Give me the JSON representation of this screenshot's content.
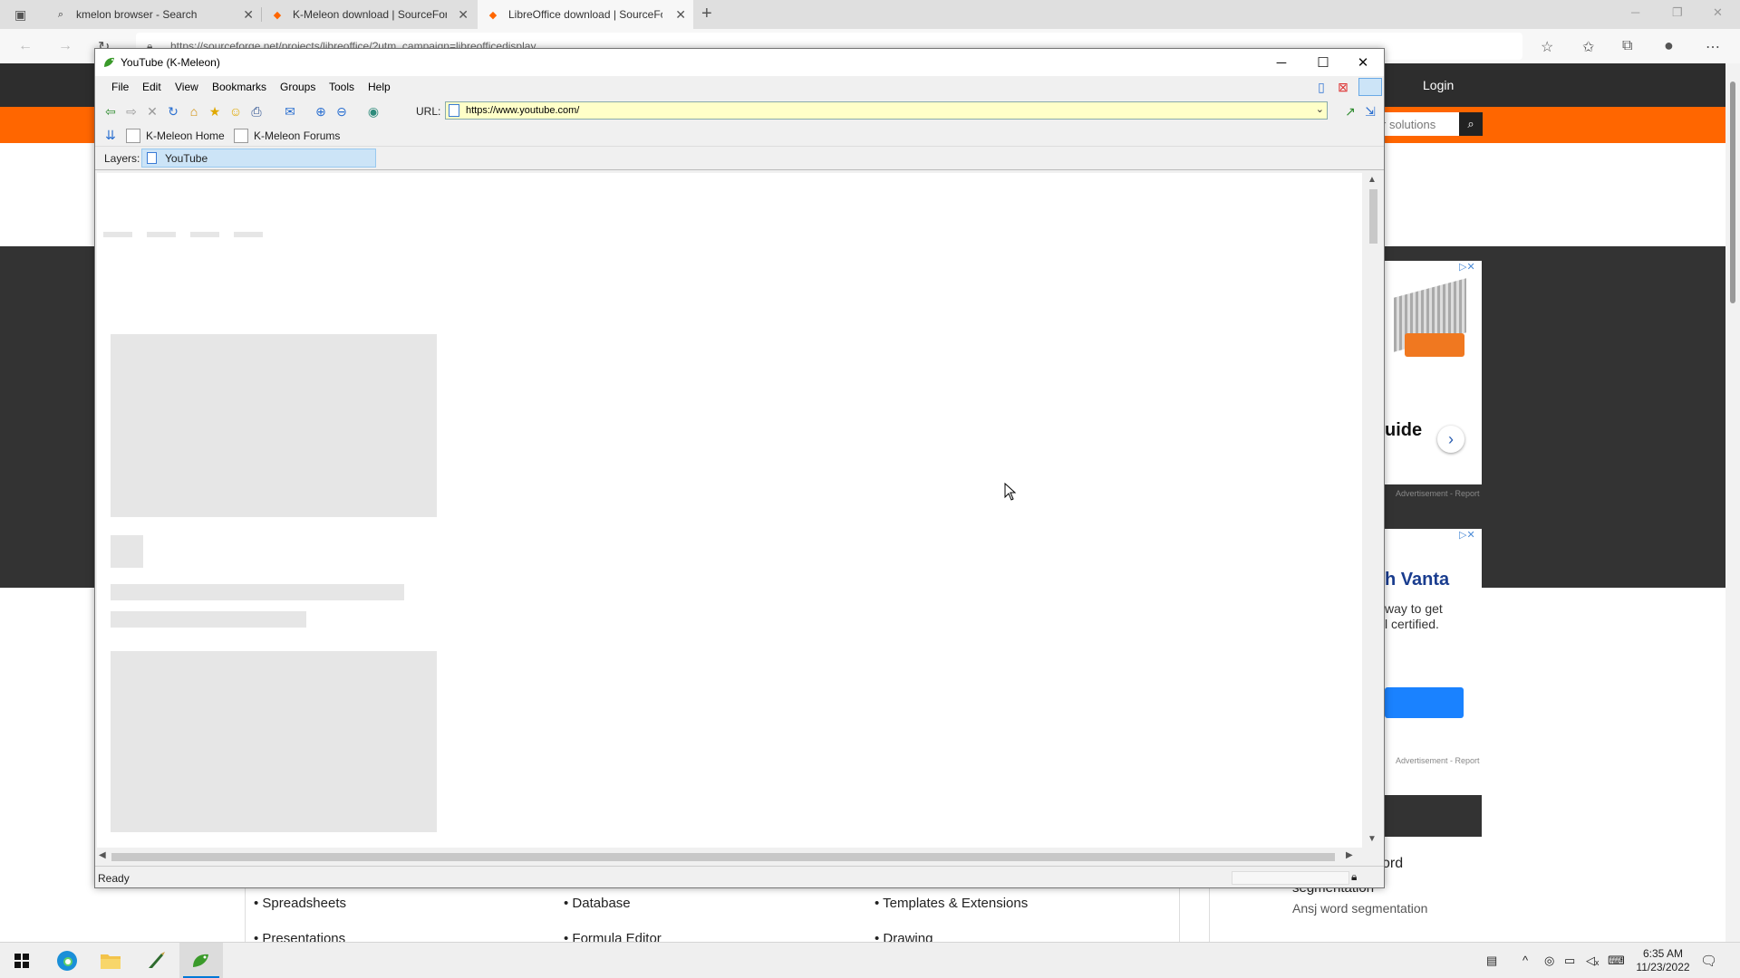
{
  "edge": {
    "tabs": [
      {
        "title": "kmelon browser - Search",
        "icon": "search-icon"
      },
      {
        "title": "K-Meleon download | SourceFor",
        "icon": "sourceforge-icon"
      },
      {
        "title": "LibreOffice download | SourceFo",
        "icon": "sourceforge-icon"
      }
    ],
    "address": "https://sourceforge.net/projects/libreoffice/?utm_campaign=libreofficedisplay"
  },
  "sourceforge": {
    "login_label": "Login",
    "search_placeholder": "r solutions",
    "ad1_text": "uide",
    "ad_label": "Advertisement - Report",
    "ad2_title": "h Vanta",
    "ad2_line1": "way to get",
    "ad2_line2": "l certified.",
    "word_label": "ord",
    "segmentation_title": "segmentation",
    "segmentation_sub": "Ansj word segmentation",
    "features_row1": [
      "Spreadsheets",
      "Database",
      "Templates & Extensions"
    ],
    "features_row2": [
      "Presentations",
      "Formula Editor",
      "Drawing"
    ]
  },
  "kmeleon": {
    "window_title": "YouTube (K-Meleon)",
    "menu": [
      "File",
      "Edit",
      "View",
      "Bookmarks",
      "Groups",
      "Tools",
      "Help"
    ],
    "url_label": "URL:",
    "url": "https://www.youtube.com/",
    "bookmarks": [
      "K-Meleon Home",
      "K-Meleon Forums"
    ],
    "layers_label": "Layers:",
    "layer_tab": "YouTube",
    "status": "Ready"
  },
  "taskbar": {
    "time": "6:35 AM",
    "date": "11/23/2022"
  },
  "colors": {
    "sf_orange": "#ff6600",
    "sf_dark": "#333333",
    "url_bg": "#ffffc8",
    "layer_tab": "#cce4f7"
  }
}
